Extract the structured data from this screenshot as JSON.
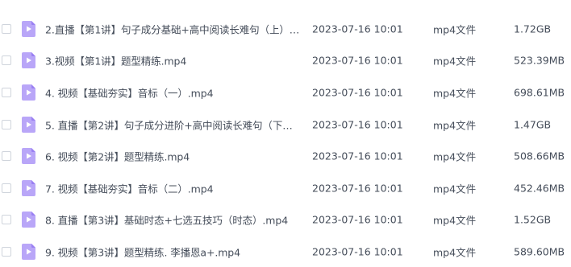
{
  "colors": {
    "icon_bg": "#b9a6f8",
    "icon_fold": "#9a80f2",
    "icon_play": "#ffffff",
    "text": "#454d5a"
  },
  "files": [
    {
      "name": "2.直播【第1讲】句子成分基础+高中阅读长难句（上）.m...",
      "modified": "2023-07-16 10:01",
      "type": "mp4文件",
      "size": "1.72GB",
      "icon": "video-file-icon"
    },
    {
      "name": "3.视频【第1讲】题型精练.mp4",
      "modified": "2023-07-16 10:01",
      "type": "mp4文件",
      "size": "523.39MB",
      "icon": "video-file-icon"
    },
    {
      "name": "4. 视频【基础夯实】音标（一）.mp4",
      "modified": "2023-07-16 10:01",
      "type": "mp4文件",
      "size": "698.61MB",
      "icon": "video-file-icon"
    },
    {
      "name": "5. 直播【第2讲】句子成分进阶+高中阅读长难句（下）....",
      "modified": "2023-07-16 10:01",
      "type": "mp4文件",
      "size": "1.47GB",
      "icon": "video-file-icon"
    },
    {
      "name": "6. 视频【第2讲】题型精练.mp4",
      "modified": "2023-07-16 10:01",
      "type": "mp4文件",
      "size": "508.66MB",
      "icon": "video-file-icon"
    },
    {
      "name": "7. 视频【基础夯实】音标（二）.mp4",
      "modified": "2023-07-16 10:01",
      "type": "mp4文件",
      "size": "452.46MB",
      "icon": "video-file-icon"
    },
    {
      "name": "8. 直播【第3讲】基础时态+七选五技巧（时态）.mp4",
      "modified": "2023-07-16 10:01",
      "type": "mp4文件",
      "size": "1.52GB",
      "icon": "video-file-icon"
    },
    {
      "name": "9. 视频【第3讲】题型精练. 李播恩a+.mp4",
      "modified": "2023-07-16 10:01",
      "type": "mp4文件",
      "size": "589.60MB",
      "icon": "video-file-icon"
    }
  ]
}
